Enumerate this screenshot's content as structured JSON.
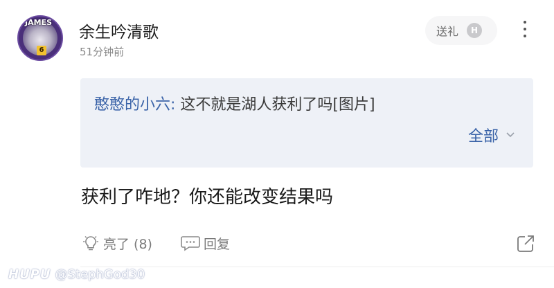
{
  "post": {
    "avatar_badge": "JAMES",
    "avatar_number": "6",
    "username": "余生吟清歌",
    "time": "51分钟前",
    "gift_label": "送礼",
    "gift_icon_letter": "H",
    "more_icon": "more-vertical-icon"
  },
  "quote": {
    "author": "憨憨的小六:",
    "text": " 这不就是湖人获利了吗[图片]",
    "expand_label": "全部"
  },
  "reply": {
    "text": "获利了咋地？你还能改变结果吗"
  },
  "actions": {
    "like_label": "亮了 (8)",
    "reply_label": "回复",
    "share_icon": "share-icon"
  },
  "watermark": {
    "logo": "HUPU",
    "handle": "@StephGod30"
  },
  "colors": {
    "link_blue": "#3a63a8",
    "quote_bg": "#eef1f7",
    "muted": "#8a8a8a"
  }
}
